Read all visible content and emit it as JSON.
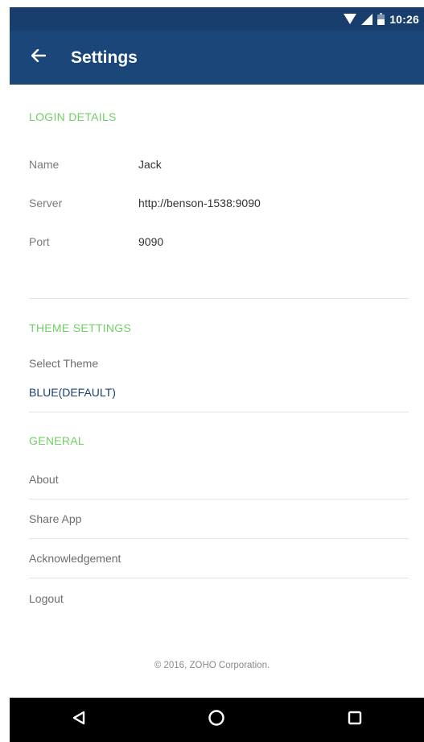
{
  "status_bar": {
    "time": "10:26",
    "icons": [
      "wifi-icon",
      "signal-icon",
      "battery-icon"
    ]
  },
  "app_bar": {
    "title": "Settings",
    "back_icon": "arrow-left-icon"
  },
  "login_details": {
    "header": "LOGIN DETAILS",
    "rows": [
      {
        "key": "Name",
        "value": "Jack"
      },
      {
        "key": "Server",
        "value": "http://benson-1538:9090"
      },
      {
        "key": "Port",
        "value": "9090"
      }
    ]
  },
  "theme_settings": {
    "header": "THEME SETTINGS",
    "select_label": "Select Theme",
    "selected_value": "BLUE(DEFAULT)"
  },
  "general": {
    "header": "GENERAL",
    "items": [
      "About",
      "Share App",
      "Acknowledgement",
      "Logout"
    ]
  },
  "footer": {
    "copyright": "© 2016, ZOHO Corporation."
  },
  "nav_bar": {
    "icons": [
      "back-triangle-icon",
      "home-circle-icon",
      "recents-square-icon"
    ]
  },
  "colors": {
    "primary": "#1b4679",
    "status_bar": "#173e6c",
    "section_header": "#72cf66",
    "value_accent": "#1b3f6e"
  }
}
